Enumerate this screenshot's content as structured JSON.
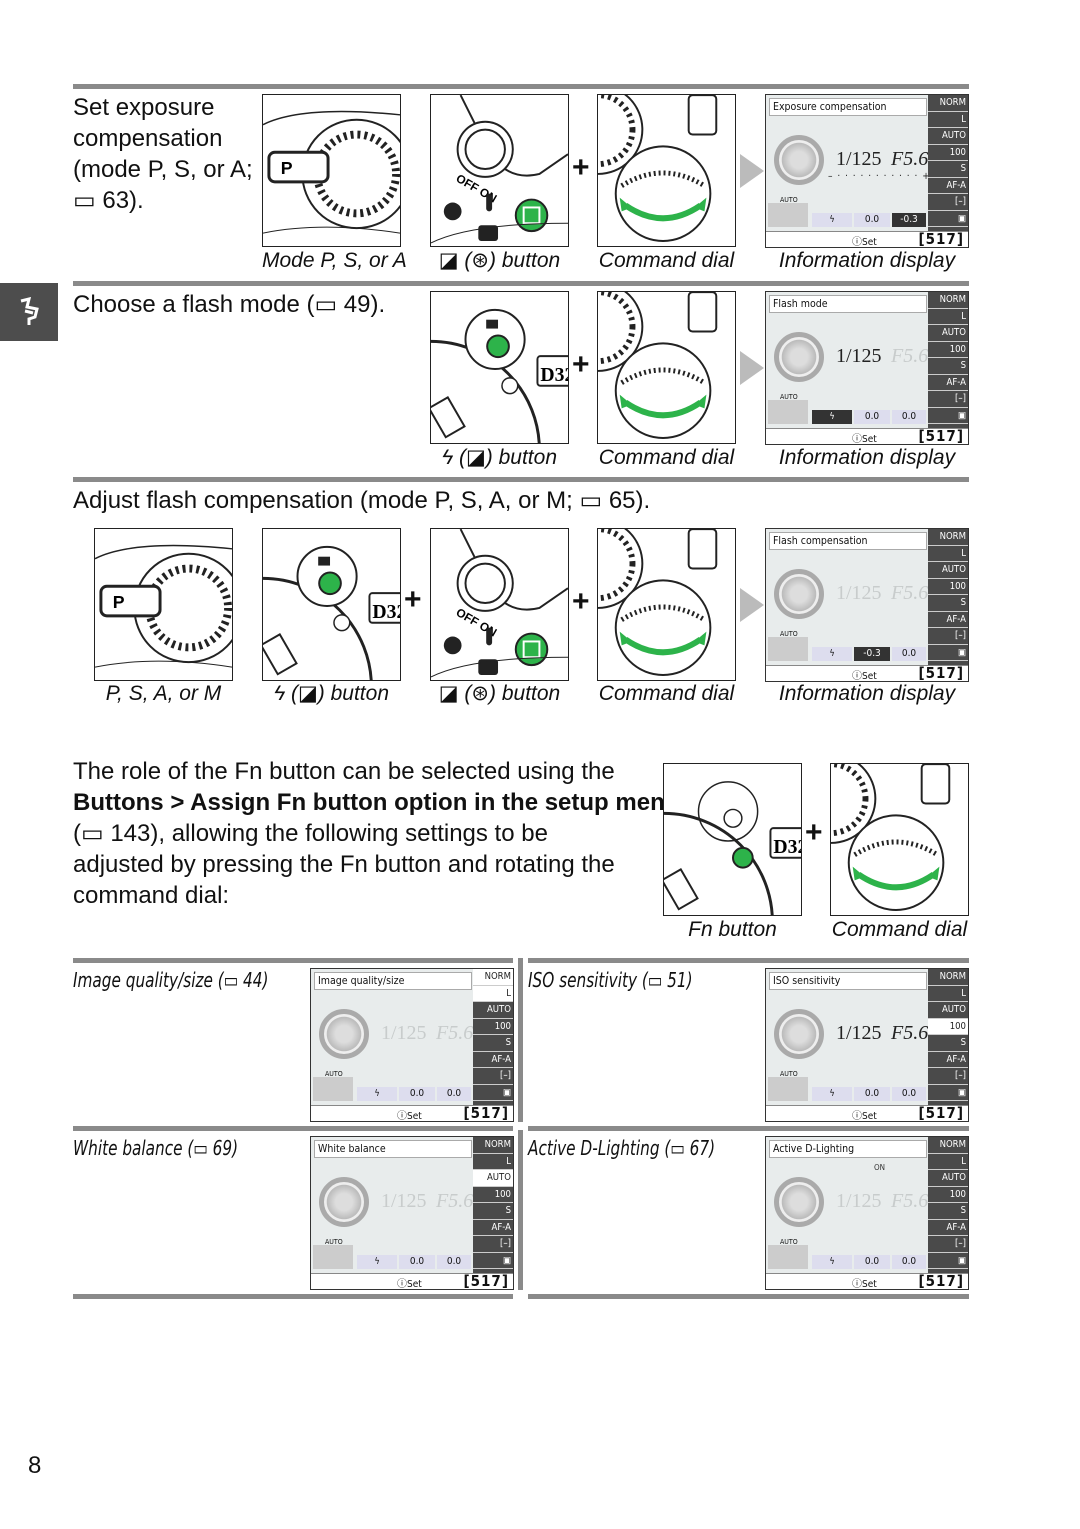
{
  "section1": {
    "text_lines": [
      "Set exposure",
      "compensation",
      "(mode P, S, or A;",
      "▭ 63)."
    ],
    "captions": [
      "Mode P, S, or A",
      "◪ (⊛) button",
      "Command dial",
      "Information display"
    ]
  },
  "section2": {
    "text": "Choose a flash mode (▭ 49).",
    "captions": [
      "ϟ (◪) button",
      "Command dial",
      "Information display"
    ]
  },
  "section3": {
    "text": "Adjust flash compensation (mode P, S, A, or M; ▭ 65).",
    "captions": [
      "P, S, A, or M",
      "ϟ (◪) button",
      "◪ (⊛) button",
      "Command dial",
      "Information display"
    ]
  },
  "fn": {
    "lines": [
      "The role of the Fn button can be selected using the",
      "Buttons > Assign Fn button option in the setup menu",
      "(▭ 143), allowing the following settings to be",
      "adjusted by pressing the Fn button and rotating the",
      "command dial:"
    ],
    "captions": [
      "Fn button",
      "Command dial"
    ]
  },
  "settings": [
    {
      "label": "Image quality/size (▭ 44)"
    },
    {
      "label": "ISO sensitivity (▭ 51)"
    },
    {
      "label": "White balance (▭ 69)"
    },
    {
      "label": "Active D-Lighting (▭ 67)"
    }
  ],
  "display_common": {
    "qual": "NORM",
    "size": "L",
    "wb": "AUTO",
    "iso": "100",
    "s": "S",
    "af": "AF-A",
    "area": "[–]",
    "meter": "▣",
    "auto": "AUTO",
    "set": "ⓘSet",
    "count": "[517]",
    "flash_icon": "ϟ"
  },
  "displays": [
    {
      "title": "Exposure compensation",
      "shutter": "1/125",
      "aperture": "F5.6",
      "faded": false,
      "meter_bar": "– · · · · · · · · · · · +",
      "flash_comp": "0.0",
      "exp_comp": "-0.3",
      "highlight": "exp"
    },
    {
      "title": "Flash mode",
      "shutter": "1/125",
      "aperture": "F5.6",
      "faded": false,
      "aperture_faded": true,
      "flash_comp": "0.0",
      "exp_comp": "0.0",
      "highlight": "flash"
    },
    {
      "title": "Flash compensation",
      "shutter": "1/125",
      "aperture": "F5.6",
      "faded": true,
      "flash_comp": "-0.3",
      "exp_comp": "0.0",
      "highlight": "fc"
    },
    {
      "title": "Image quality/size",
      "shutter": "1/125",
      "aperture": "F5.6",
      "faded": true,
      "flash_comp": "0.0",
      "exp_comp": "0.0",
      "highlight": "qual"
    },
    {
      "title": "ISO sensitivity",
      "shutter": "1/125",
      "aperture": "F5.6",
      "faded": false,
      "flash_comp": "0.0",
      "exp_comp": "0.0",
      "highlight": "iso"
    },
    {
      "title": "White balance",
      "shutter": "1/125",
      "aperture": "F5.6",
      "faded": true,
      "flash_comp": "0.0",
      "exp_comp": "0.0",
      "highlight": "wb"
    },
    {
      "title": "Active D-Lighting",
      "shutter": "1/125",
      "aperture": "F5.6",
      "faded": true,
      "adl": "ON",
      "flash_comp": "0.0",
      "exp_comp": "0.0",
      "highlight": "none"
    }
  ],
  "page_number": "8",
  "colors": {
    "rule": "#8a8a8a",
    "tab": "#4d4d4d",
    "button_green": "#2db34a",
    "arrow": "#2db34a"
  }
}
